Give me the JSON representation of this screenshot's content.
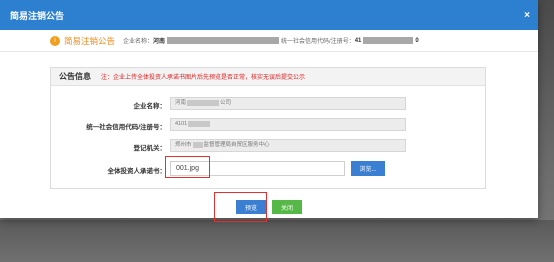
{
  "dialog": {
    "title": "简易注销公告",
    "close_icon": "×"
  },
  "header": {
    "icon_char": "i",
    "title": "简易注销公告",
    "company_label": "企业名称：",
    "company_value_prefix": "河南",
    "credit_label": "统一社会信用代码/注册号：",
    "credit_value_prefix": "41",
    "credit_value_suffix": "0"
  },
  "panel": {
    "title": "公告信息",
    "note": "注：企业上传全体投资人承诺书图片后先预览是否正常，核实无误后提交公示"
  },
  "form": {
    "company_name_label": "企业名称：",
    "company_name_value": "河南",
    "company_name_suffix": "公司",
    "credit_code_label": "统一社会信用代码/注册号：",
    "credit_code_value": "4101",
    "authority_label": "登记机关：",
    "authority_value": "郑州市",
    "authority_suffix": "监督管理局自贸区服务中心",
    "commitment_label": "全体投资人承诺书：",
    "commitment_file": "001.jpg",
    "browse_label": "浏览..."
  },
  "actions": {
    "preview_label": "预览",
    "close_label": "关闭"
  }
}
